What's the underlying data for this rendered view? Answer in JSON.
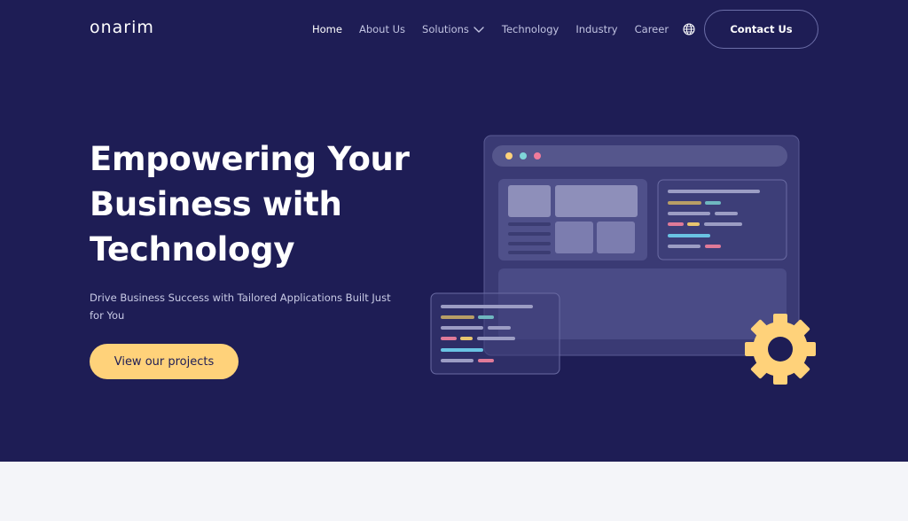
{
  "brand": {
    "logo_text": "onarim"
  },
  "nav": {
    "items": [
      {
        "label": "Home",
        "active": true
      },
      {
        "label": "About Us"
      },
      {
        "label": "Solutions",
        "has_dropdown": true
      },
      {
        "label": "Technology"
      },
      {
        "label": "Industry"
      },
      {
        "label": "Career"
      }
    ],
    "language_icon": "globe-icon",
    "contact_label": "Contact Us"
  },
  "hero": {
    "headline_lines": [
      "Empowering Your",
      "Business with",
      "Technology"
    ],
    "subtitle": "Drive Business Success with Tailored Applications Built Just for You",
    "cta_label": "View our projects"
  },
  "colors": {
    "hero_bg": "#1e1d55",
    "accent": "#ffd27a",
    "page_bg": "#f4f5f9",
    "text_light": "#c9cbe6"
  }
}
